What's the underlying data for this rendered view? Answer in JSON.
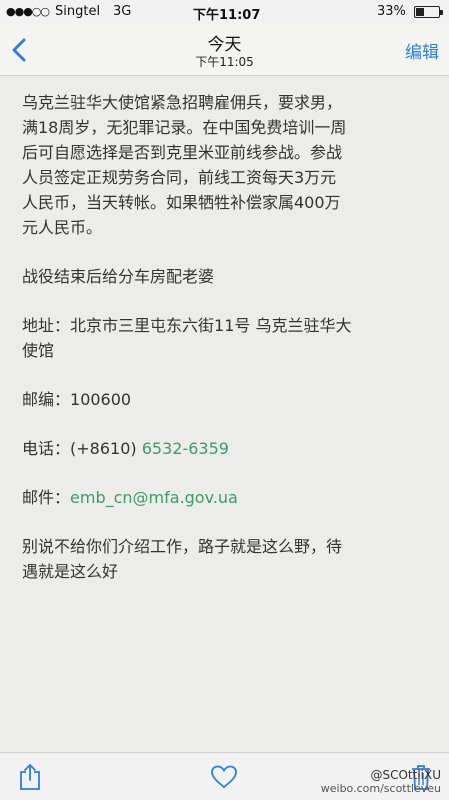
{
  "status_bar": {
    "signal": "●●●○○",
    "carrier": "Singtel",
    "network": "3G",
    "time": "下午11:07",
    "battery": "33%"
  },
  "nav": {
    "back_icon": "chevron-left-icon",
    "title": "今天",
    "subtitle": "下午11:05",
    "edit_label": "编辑"
  },
  "message": {
    "line1": "乌克兰驻华大使馆紧急招聘雇佣兵，要求男，",
    "line2": "满18周岁，无犯罪记录。在中国免费培训一周",
    "line3": "后可自愿选择是否到克里米亚前线参战。参战",
    "line4": "人员签定正规劳务合同，前线工资每天3万元",
    "line5": "人民币，当天转帐。如果牺牲补偿家属400万",
    "line6": "元人民币。",
    "perks": "战役结束后给分车房配老婆",
    "address_label": "地址：",
    "address_line1": "北京市三里屯东六街11号 乌克兰驻华大",
    "address_line2": "使馆",
    "postcode_label": "邮编：",
    "postcode": "100600",
    "phone_label": "电话：",
    "phone_prefix": "(+8610) ",
    "phone_number": "6532-6359",
    "email_label": "邮件：",
    "email": "emb_cn@mfa.gov.ua",
    "closing_line1": "别说不给你们介绍工作，路子就是这么野，待",
    "closing_line2": "遇就是这么好"
  },
  "toolbar": {
    "share_icon": "share-icon",
    "like_icon": "heart-icon",
    "delete_icon": "trash-icon"
  },
  "watermark": {
    "handle": "@SCOttliXU",
    "url": "weibo.com/scottleveu"
  },
  "colors": {
    "accent": "#2f7ed8",
    "link": "#3f9a6b",
    "background": "#ececeb"
  }
}
